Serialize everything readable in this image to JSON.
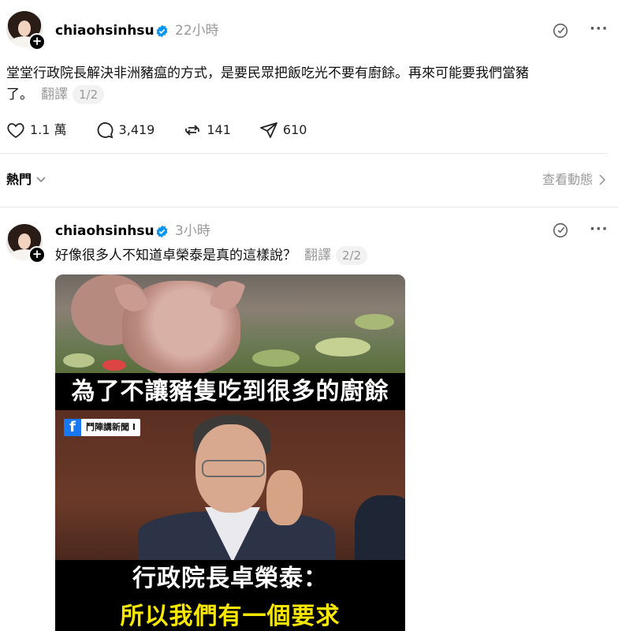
{
  "post1": {
    "username": "chiaohsinhsu",
    "time": "22小時",
    "text_line1": "堂堂行政院長解決非洲豬瘟的方式，是要民眾把飯吃光不要有廚餘。再來可能要我們當豬",
    "text_line2": "了。",
    "translate": "翻譯",
    "pager": "1/2",
    "likes": "1.1 萬",
    "comments": "3,419",
    "reposts": "141",
    "shares": "610"
  },
  "feed": {
    "hot_label": "熱門",
    "activity_label": "查看動態"
  },
  "post2": {
    "username": "chiaohsinhsu",
    "time": "3小時",
    "text": "好像很多人不知道卓榮泰是真的這樣說？",
    "translate": "翻譯",
    "pager": "2/2",
    "image": {
      "caption_top": "為了不讓豬隻吃到很多的廚餘",
      "source_tag": "鬥陣講新聞 I",
      "caption_mid": "行政院長卓榮泰：",
      "caption_bottom": "所以我們有一個要求"
    }
  },
  "colors": {
    "verified_blue": "#0095f6",
    "muted_text": "#999999",
    "caption_yellow": "#f7e600"
  },
  "icons": [
    "verified-icon",
    "sticker-icon",
    "more-icon",
    "heart-icon",
    "comment-icon",
    "repost-icon",
    "share-icon",
    "chevron-down-icon",
    "chevron-right-icon",
    "plus-icon"
  ]
}
